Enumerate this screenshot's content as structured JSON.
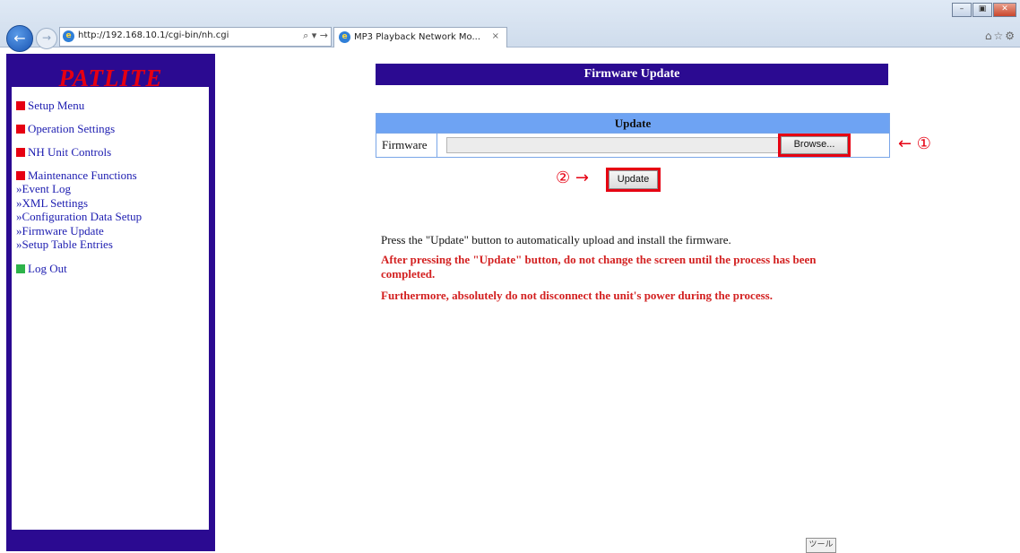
{
  "browser": {
    "url": "http://192.168.10.1/cgi-bin/nh.cgi",
    "address_tools": "⌕ ▾ →",
    "tab_title": "MP3 Playback Network Mo...",
    "tab_close": "×",
    "right_icons": "⌂☆⚙",
    "back_icon": "←",
    "forward_icon": "→",
    "win_minimize": "–",
    "win_restore": "▣",
    "win_close": "✕",
    "ie_glyph": "e",
    "tools_button": "ツール"
  },
  "sidebar": {
    "logo": "PATLITE",
    "items": [
      {
        "label": "Setup Menu",
        "color": "#e60012"
      },
      {
        "label": "Operation Settings",
        "color": "#e60012"
      },
      {
        "label": "NH Unit Controls",
        "color": "#e60012"
      },
      {
        "label": "Maintenance Functions",
        "color": "#e60012"
      },
      {
        "label": "Log Out",
        "color": "#2db34a"
      }
    ],
    "sub_items": [
      "»Event Log",
      "»XML Settings",
      "»Configuration Data Setup",
      "»Firmware Update",
      "»Setup Table Entries"
    ]
  },
  "main": {
    "title": "Firmware Update",
    "table_header": "Update",
    "firmware_label": "Firmware",
    "firmware_value": "",
    "browse_label": "Browse...",
    "update_label": "Update",
    "annotation_1": "← ①",
    "annotation_2": "② →",
    "instruction": "Press the \"Update\" button to automatically upload and install the firmware.",
    "warning_1": "After pressing the \"Update\" button, do not change the screen until the process has been completed.",
    "warning_2": "Furthermore, absolutely do not disconnect the unit's power during the process."
  },
  "colors": {
    "sidebar_bg": "#2b0a91",
    "logo_red": "#e60012",
    "header_blue": "#6ea3f3",
    "warning_red": "#d32121",
    "highlight_red": "#e60012"
  }
}
